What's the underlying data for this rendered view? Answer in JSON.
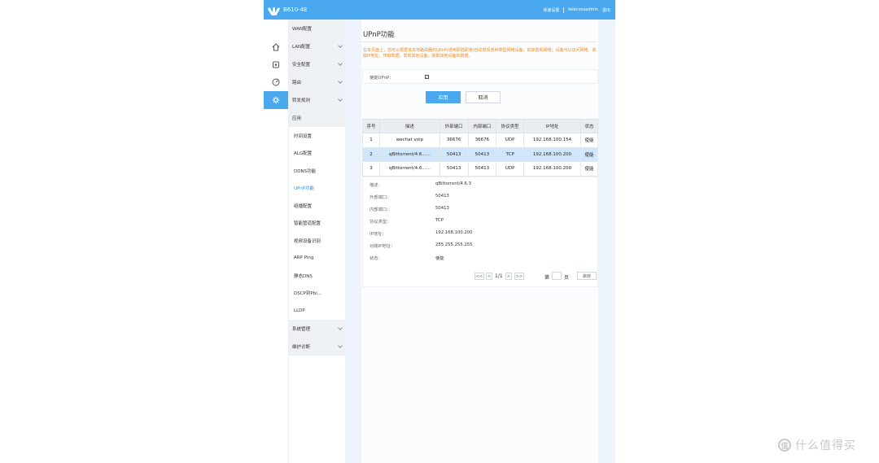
{
  "header": {
    "model": "B610-4E",
    "links": [
      "快速设置",
      "teleconsadmin",
      "退出"
    ],
    "brand_color": "#4aa9ee"
  },
  "iconbar": [
    {
      "icon": "home-icon"
    },
    {
      "icon": "router-icon"
    },
    {
      "icon": "gauge-icon"
    },
    {
      "icon": "gear-icon",
      "active": true
    }
  ],
  "menu": {
    "items": [
      "WAN配置",
      "LAN配置",
      "安全配置",
      "路由",
      "转发规则",
      "应用"
    ],
    "sub_items": [
      "时间设置",
      "ALG配置",
      "DDNS功能",
      "UPnP功能",
      "组播配置",
      "智能管道配置",
      "视频设备识别",
      "ARP Ping",
      "静态DNS",
      "DSCP到Pbi...",
      "LLDP"
    ],
    "bottom_items": [
      "系统管理",
      "维护诊断"
    ]
  },
  "page": {
    "title": "UPnP功能",
    "description": "在本页面上，您可以根据该本地路由器的UPnP(通用即插即用)自动发现各种类型网络设备，如家庭和网络；设备可以访问网络，获取IP地址，传输数据，发现其他设备，获取其他设备的数据。",
    "enable_label": "使能UPnP：",
    "enable_checked": "✓",
    "apply_label": "应用",
    "cancel_label": "取消"
  },
  "table": {
    "headers": [
      "序号",
      "描述",
      "外部端口",
      "内部端口",
      "协议类型",
      "IP地址",
      "状态"
    ],
    "rows": [
      [
        "1",
        "wechat voip",
        "36676",
        "36676",
        "UDP",
        "192.168.100.154",
        "使能"
      ],
      [
        "2",
        "qBittorrent/4.6......",
        "50413",
        "50413",
        "TCP",
        "192.168.100.200",
        "使能"
      ],
      [
        "3",
        "qBittorrent/4.6......",
        "50413",
        "50413",
        "UDP",
        "192.168.100.200",
        "使能"
      ]
    ],
    "selected_row": 2
  },
  "detail": {
    "labels": [
      "描述：",
      "外部端口：",
      "内部端口：",
      "协议类型：",
      "IP地址：",
      "对端IP地址：",
      "状态："
    ],
    "values": [
      "qBittorrent/4.6.3",
      "50413",
      "50413",
      "TCP",
      "192.168.100.200",
      "255.255.255.255",
      "使能"
    ]
  },
  "pagination": {
    "first": "<<",
    "prev": "<",
    "info": "1/1",
    "next": ">",
    "last": ">>",
    "goto_prefix": "第",
    "goto_suffix": "页",
    "jump_label": "跳转"
  },
  "watermark": {
    "logo": "值",
    "text": "什么值得买"
  }
}
